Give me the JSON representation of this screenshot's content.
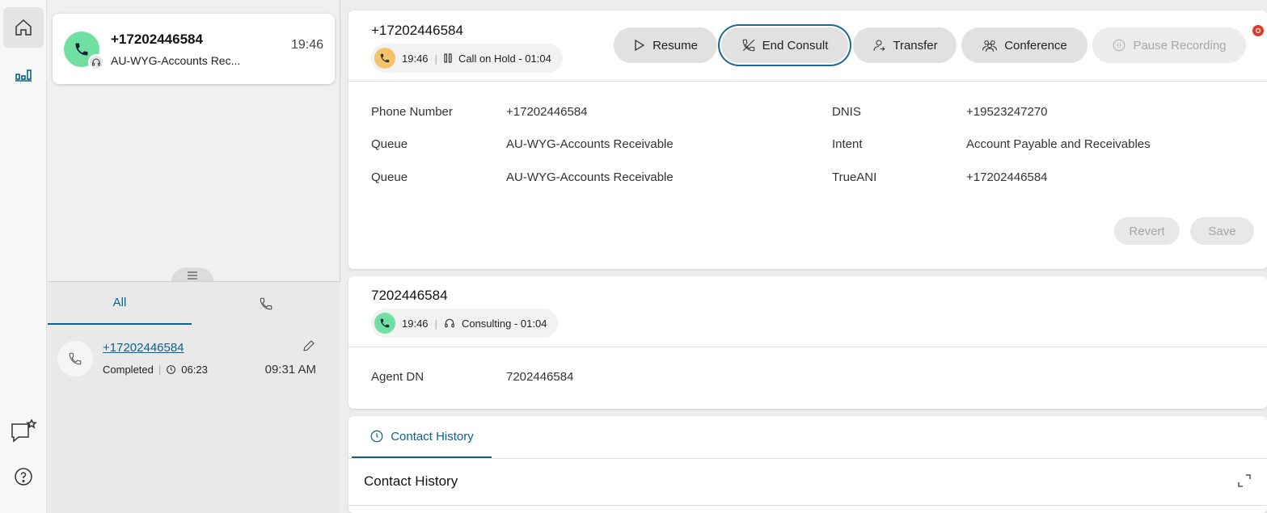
{
  "task": {
    "title": "+17202446584",
    "time": "19:46",
    "queue": "AU-WYG-Accounts Rec..."
  },
  "history": {
    "tabs": [
      "All",
      "phone-icon"
    ],
    "item": {
      "number": "+17202446584",
      "status": "Completed",
      "duration": "06:23",
      "time": "09:31 AM"
    }
  },
  "call1": {
    "number": "+17202446584",
    "time": "19:46",
    "state": "Call on Hold - 01:04",
    "actions": {
      "resume": "Resume",
      "end_consult": "End Consult",
      "transfer": "Transfer",
      "conference": "Conference",
      "pause_recording": "Pause Recording"
    },
    "fields": {
      "phone_label": "Phone Number",
      "phone_value": "+17202446584",
      "queue1_label": "Queue",
      "queue1_value": "AU-WYG-Accounts Receivable",
      "queue2_label": "Queue",
      "queue2_value": "AU-WYG-Accounts Receivable",
      "dnis_label": "DNIS",
      "dnis_value": "+19523247270",
      "intent_label": "Intent",
      "intent_value": "Account Payable and Receivables",
      "trueani_label": "TrueANI",
      "trueani_value": "+17202446584"
    },
    "revert": "Revert",
    "save": "Save"
  },
  "call2": {
    "number": "7202446584",
    "time": "19:46",
    "state": "Consulting - 01:04",
    "agent_dn_label": "Agent DN",
    "agent_dn_value": "7202446584"
  },
  "contact_history": {
    "tab_label": "Contact History",
    "title": "Contact History"
  },
  "colors": {
    "accent": "#0b6291",
    "green": "#6fe0a2",
    "hold": "#f5c36b",
    "alert": "#e4382a"
  }
}
